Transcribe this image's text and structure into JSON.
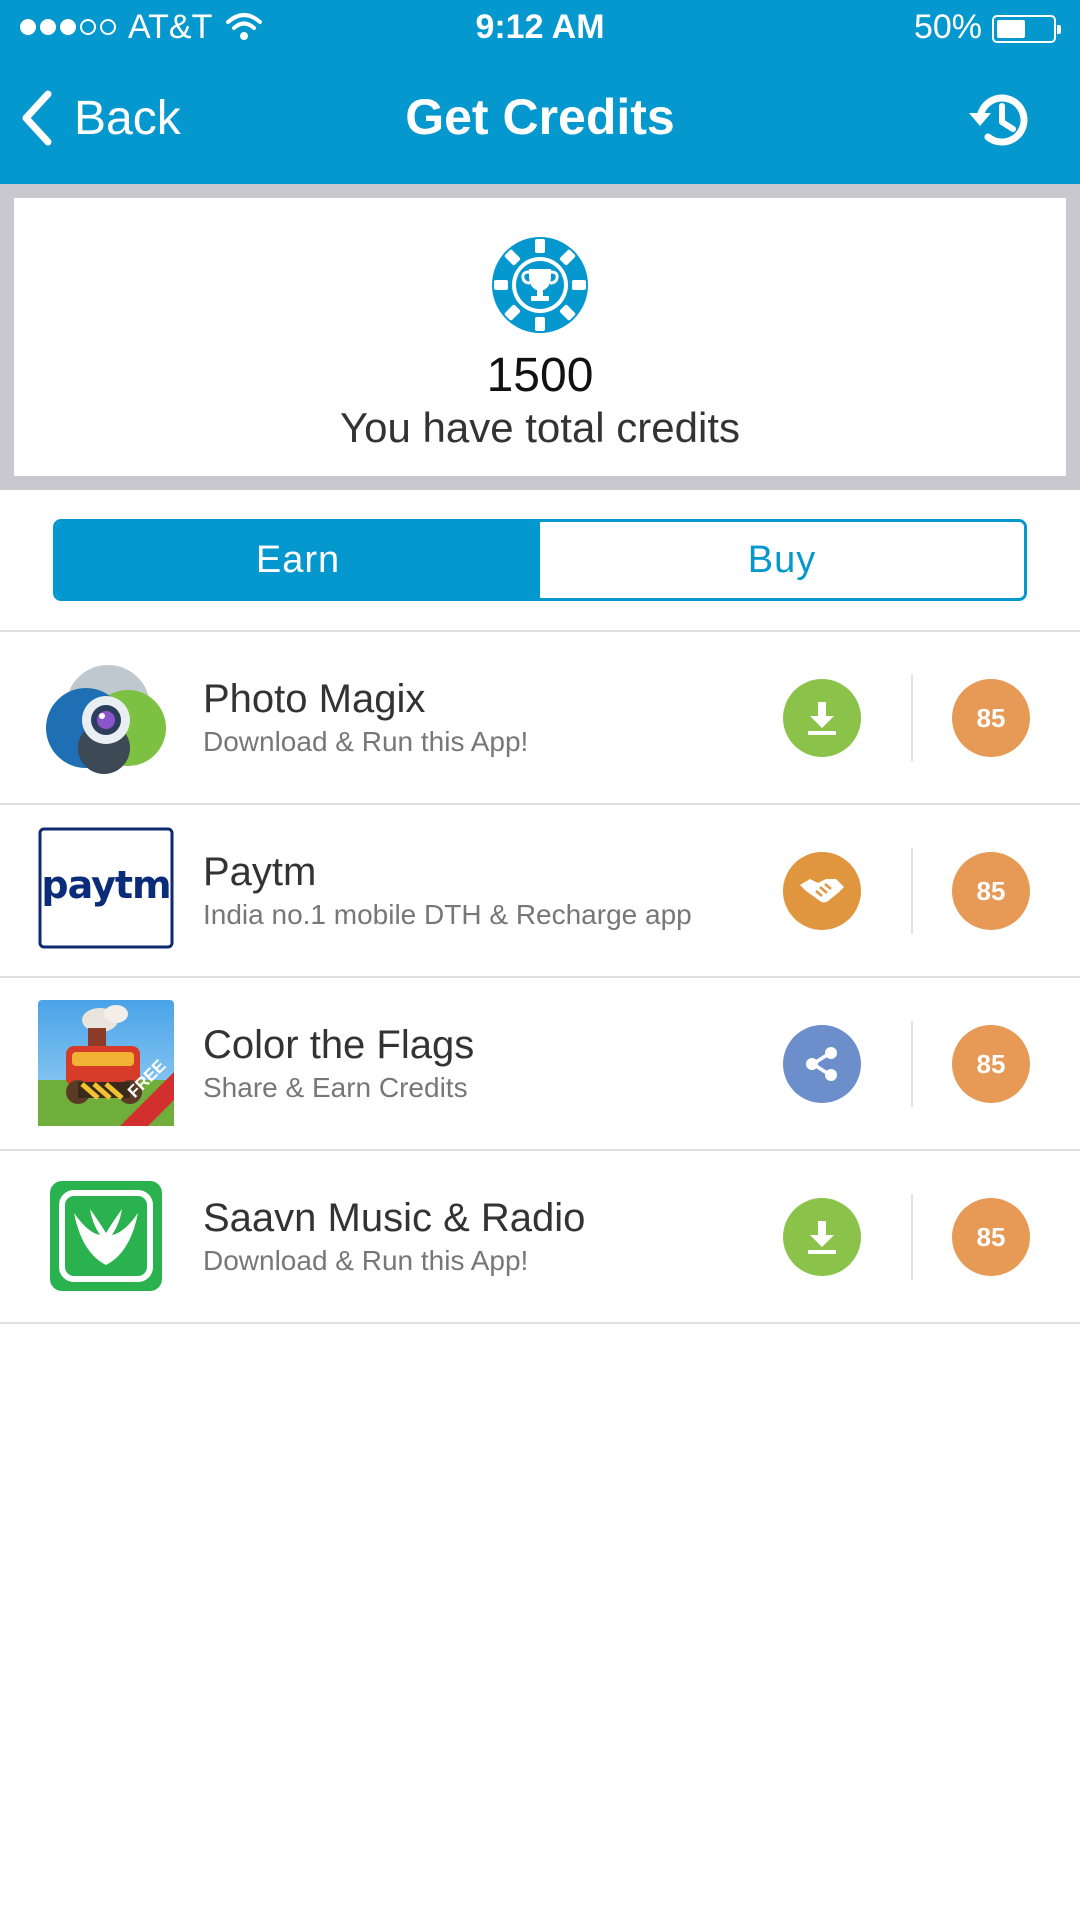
{
  "status_bar": {
    "carrier": "AT&T",
    "time": "9:12 AM",
    "battery": "50%",
    "battery_level": 0.5,
    "signal_bars": 3,
    "signal_total": 5
  },
  "nav": {
    "back_label": "Back",
    "title": "Get Credits",
    "right_icon": "history-icon"
  },
  "credits": {
    "value": "1500",
    "label": "You have total credits",
    "icon": "trophy-chip-icon"
  },
  "tabs": [
    {
      "label": "Earn",
      "active": true
    },
    {
      "label": "Buy",
      "active": false
    }
  ],
  "offers": [
    {
      "title": "Photo Magix",
      "subtitle": "Download & Run this App!",
      "action": "download-icon",
      "action_color": "#8bc34a",
      "credits": "85"
    },
    {
      "title": "Paytm",
      "subtitle": "India no.1 mobile DTH & Recharge app",
      "action": "handshake-icon",
      "action_color": "#e0953f",
      "credits": "85",
      "logo_text": "paytm"
    },
    {
      "title": "Color the Flags",
      "subtitle": "Share & Earn Credits",
      "action": "share-icon",
      "action_color": "#6c8fcb",
      "credits": "85",
      "badge_text": "FREE"
    },
    {
      "title": "Saavn Music & Radio",
      "subtitle": "Download & Run this App!",
      "action": "download-icon",
      "action_color": "#8bc34a",
      "credits": "85"
    }
  ],
  "colors": {
    "primary": "#0598cf",
    "credit_badge": "#e69a55"
  }
}
